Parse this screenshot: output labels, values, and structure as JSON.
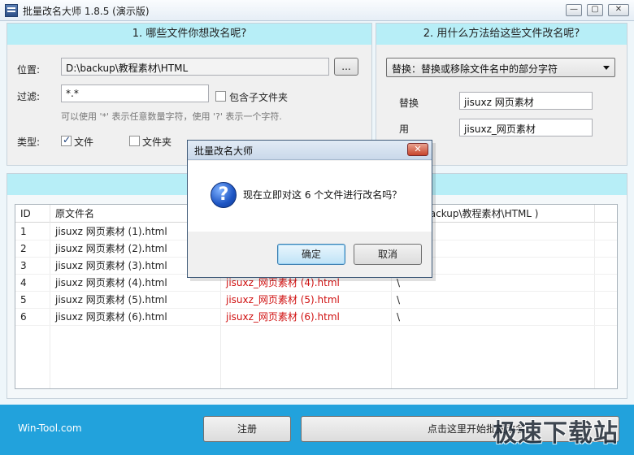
{
  "window": {
    "title": "批量改名大师 1.8.5 (演示版)",
    "min": "—",
    "max": "▢",
    "close": "✕"
  },
  "section1": {
    "header": "1. 哪些文件你想改名呢?",
    "location_label": "位置:",
    "location_value": "D:\\backup\\教程素材\\HTML",
    "browse_label": "...",
    "filter_label": "过滤:",
    "filter_value": "*.*",
    "include_subfolders_label": "包含子文件夹",
    "include_subfolders_checked": false,
    "hint": "可以使用 '*' 表示任意数量字符，使用 '?' 表示一个字符.",
    "type_label": "类型:",
    "type_file_label": "文件",
    "type_file_checked": true,
    "type_folder_label": "文件夹",
    "type_folder_checked": false
  },
  "section2": {
    "header": "2. 用什么方法给这些文件改名呢?",
    "method_selected": "替换：替换或移除文件名中的部分字符",
    "replace_label": "替换",
    "replace_value": "jisuxz 网页素材",
    "with_label": "用",
    "with_value": "jisuxz_网页素材"
  },
  "table": {
    "columns": [
      "ID",
      "原文件名",
      "",
      "于 D:\\backup\\教程素材\\HTML )"
    ],
    "rows": [
      {
        "id": "1",
        "old": "jisuxz 网页素材 (1).html",
        "new": "",
        "path": ""
      },
      {
        "id": "2",
        "old": "jisuxz 网页素材 (2).html",
        "new": "",
        "path": ""
      },
      {
        "id": "3",
        "old": "jisuxz 网页素材 (3).html",
        "new": "",
        "path": ""
      },
      {
        "id": "4",
        "old": "jisuxz 网页素材 (4).html",
        "new": "jisuxz_网页素材 (4).html",
        "path": "\\"
      },
      {
        "id": "5",
        "old": "jisuxz 网页素材 (5).html",
        "new": "jisuxz_网页素材 (5).html",
        "path": "\\"
      },
      {
        "id": "6",
        "old": "jisuxz 网页素材 (6).html",
        "new": "jisuxz_网页素材 (6).html",
        "path": "\\"
      }
    ]
  },
  "footer": {
    "site": "Win-Tool.com",
    "register_label": "注册",
    "start_label": "点击这里开始批量改名",
    "watermark": "极速下载站"
  },
  "dialog": {
    "title": "批量改名大师",
    "close": "✕",
    "icon": "question-icon",
    "icon_glyph": "?",
    "message": "现在立即对这 6 个文件进行改名吗？",
    "ok_label": "确定",
    "cancel_label": "取消"
  },
  "colors": {
    "accent": "#b7eef7",
    "bottom_bar": "#22a2dc",
    "new_name": "#d01010"
  }
}
